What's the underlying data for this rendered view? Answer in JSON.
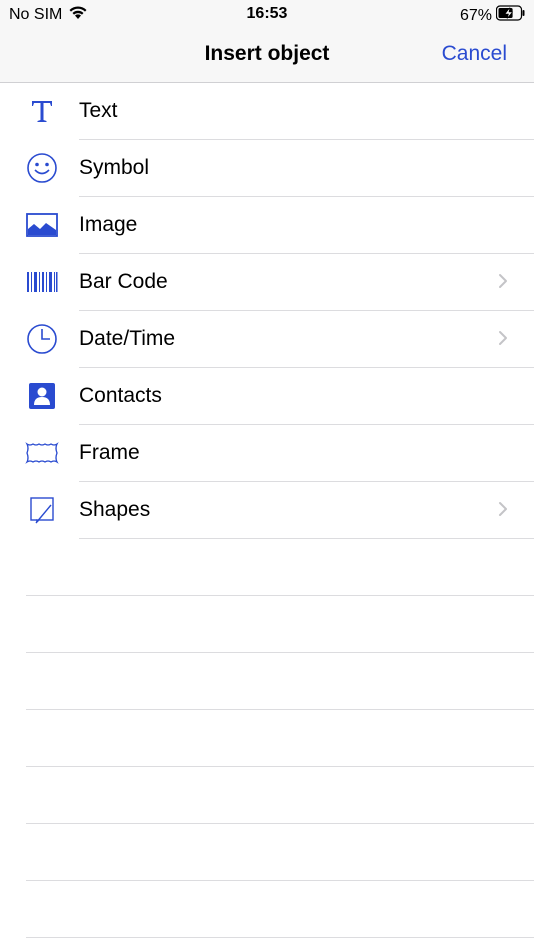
{
  "status_bar": {
    "carrier": "No SIM",
    "time": "16:53",
    "battery_percent": "67%",
    "battery_level": 0.67
  },
  "nav": {
    "title": "Insert object",
    "cancel_label": "Cancel"
  },
  "colors": {
    "accent": "#2a4bd0",
    "icon": "#2a4bd0",
    "separator": "#dcdcdf",
    "chevron": "#c4c4c7"
  },
  "items": [
    {
      "label": "Text",
      "icon": "text-icon",
      "has_chevron": false
    },
    {
      "label": "Symbol",
      "icon": "smiley-icon",
      "has_chevron": false
    },
    {
      "label": "Image",
      "icon": "image-icon",
      "has_chevron": false
    },
    {
      "label": "Bar Code",
      "icon": "barcode-icon",
      "has_chevron": true
    },
    {
      "label": "Date/Time",
      "icon": "clock-icon",
      "has_chevron": true
    },
    {
      "label": "Contacts",
      "icon": "contact-icon",
      "has_chevron": false
    },
    {
      "label": "Frame",
      "icon": "frame-icon",
      "has_chevron": false
    },
    {
      "label": "Shapes",
      "icon": "shapes-icon",
      "has_chevron": true
    }
  ]
}
